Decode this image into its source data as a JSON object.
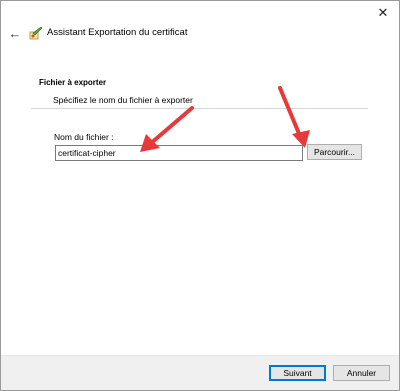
{
  "window": {
    "title": "Assistant Exportation du certificat",
    "close_glyph": "✕",
    "back_glyph": "←",
    "title_icon": "certificate-wizard-icon"
  },
  "page": {
    "section_title": "Fichier à exporter",
    "section_description": "Spécifiez le nom du fichier à exporter",
    "filename_label": "Nom du fichier :",
    "filename_value": "certificat-cipher",
    "browse_label": "Parcourir..."
  },
  "footer": {
    "next_label": "Suivant",
    "cancel_label": "Annuler"
  },
  "annotations": {
    "arrow_color": "#e8393a",
    "arrow_count": 2
  },
  "colors": {
    "accent": "#0078d7",
    "footer_bg": "#f0f0f0"
  }
}
